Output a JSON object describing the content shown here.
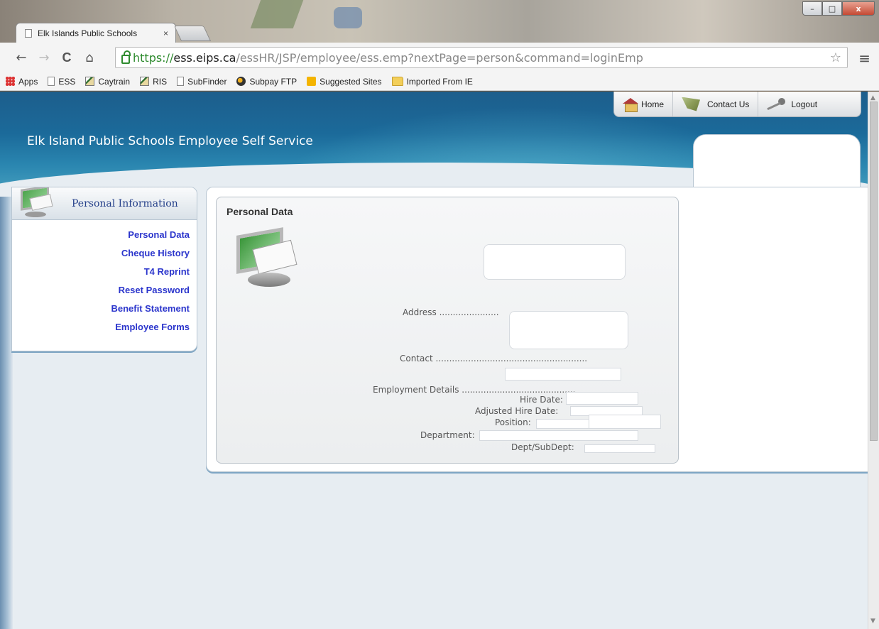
{
  "browser": {
    "tab_title": "Elk Islands Public Schools",
    "tab_close": "×",
    "url_scheme": "https://",
    "url_host": "ess.eips.ca",
    "url_path": "/essHR/JSP/employee/ess.emp?nextPage=person&command=loginEmp",
    "window_controls": {
      "minimize": "–",
      "maximize": "□",
      "close": "x"
    },
    "nav": {
      "back": "←",
      "forward": "→",
      "reload": "C",
      "home": "⌂",
      "star": "☆",
      "menu": "≡"
    },
    "bookmarks": [
      {
        "label": "Apps",
        "icon": "apps-grid-icon"
      },
      {
        "label": "ESS",
        "icon": "page-icon"
      },
      {
        "label": "Caytrain",
        "icon": "chart-icon"
      },
      {
        "label": "RIS",
        "icon": "chart-icon"
      },
      {
        "label": "SubFinder",
        "icon": "page-icon"
      },
      {
        "label": "Subpay FTP",
        "icon": "globe-icon"
      },
      {
        "label": "Suggested Sites",
        "icon": "bing-icon"
      },
      {
        "label": "Imported From IE",
        "icon": "folder-icon"
      }
    ]
  },
  "header": {
    "site_title": "Elk Island Public Schools Employee Self Service",
    "links": {
      "home": "Home",
      "contact": "Contact Us",
      "logout": "Logout"
    }
  },
  "sidebar": {
    "title": "Personal Information",
    "items": [
      "Personal Data",
      "Cheque History",
      "T4 Reprint",
      "Reset Password",
      "Benefit Statement",
      "Employee Forms"
    ]
  },
  "main": {
    "card_title": "Personal Data",
    "address_label": "Address ......................",
    "contact_label": "Contact ........................................................",
    "employment_label": "Employment Details ..........................................",
    "hire_date_label": "Hire Date:",
    "adjusted_hire_label": "Adjusted Hire Date:",
    "position_label": "Position:",
    "department_label": "Department:",
    "dept_subdept_label": "Dept/SubDept:"
  },
  "colors": {
    "banner": "#1d5e8c",
    "menu_link": "#2b35cc",
    "sidebar_title": "#25408a"
  }
}
